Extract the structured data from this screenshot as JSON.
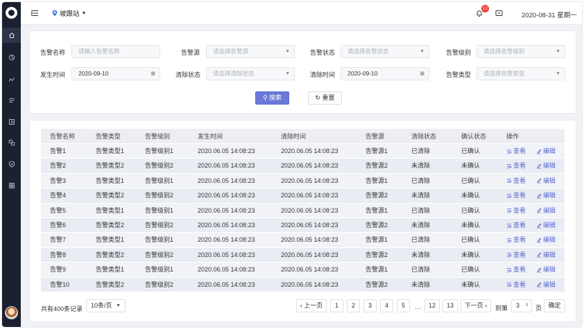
{
  "header": {
    "station": "坡跟站",
    "notification_count": "12",
    "datetime": "2020-08-31 星期一"
  },
  "sidebar": {
    "items": [
      "home-icon",
      "dashboard-icon",
      "trend-icon",
      "list-icon",
      "layout-icon",
      "resource-icon",
      "shield-icon",
      "apps-icon"
    ]
  },
  "filters": {
    "alarm_name": {
      "label": "告警名称",
      "placeholder": "请输入告警名称"
    },
    "alarm_source": {
      "label": "告警源",
      "placeholder": "请选择告警源"
    },
    "alarm_status": {
      "label": "告警状态",
      "placeholder": "请选择告警状态"
    },
    "alarm_level": {
      "label": "告警级别",
      "placeholder": "请选择告警级别"
    },
    "occur_time": {
      "label": "发生时间",
      "value": "2020-09-10"
    },
    "clear_status": {
      "label": "清除状态",
      "placeholder": "请选择清除状态"
    },
    "clear_time": {
      "label": "清除时间",
      "value": "2020-09-10"
    },
    "alarm_type": {
      "label": "告警类型",
      "placeholder": "请选择告警类型"
    },
    "search_label": "搜索",
    "reset_label": "重置"
  },
  "table": {
    "columns": [
      "告警名称",
      "告警类型",
      "告警级别",
      "发生时间",
      "清除时间",
      "告警源",
      "清除状态",
      "确认状态",
      "操作"
    ],
    "view_label": "查看",
    "edit_label": "编辑",
    "rows": [
      {
        "name": "告警1",
        "type": "告警类型1",
        "level": "告警级别1",
        "occur": "2020.06.05  14:08:23",
        "clear": "2020.06.05  14:08:23",
        "source": "告警源1",
        "clear_status": "已清除",
        "confirm_status": "已确认"
      },
      {
        "name": "告警2",
        "type": "告警类型2",
        "level": "告警级别2",
        "occur": "2020.06.05  14:08:23",
        "clear": "2020.06.05  14:08:23",
        "source": "告警源2",
        "clear_status": "未清除",
        "confirm_status": "未确认"
      },
      {
        "name": "告警3",
        "type": "告警类型1",
        "level": "告警级别1",
        "occur": "2020.06.05  14:08:23",
        "clear": "2020.06.05  14:08:23",
        "source": "告警源1",
        "clear_status": "已清除",
        "confirm_status": "已确认"
      },
      {
        "name": "告警4",
        "type": "告警类型2",
        "level": "告警级别2",
        "occur": "2020.06.05  14:08:23",
        "clear": "2020.06.05  14:08:23",
        "source": "告警源2",
        "clear_status": "未清除",
        "confirm_status": "未确认"
      },
      {
        "name": "告警5",
        "type": "告警类型1",
        "level": "告警级别1",
        "occur": "2020.06.05  14:08:23",
        "clear": "2020.06.05  14:08:23",
        "source": "告警源1",
        "clear_status": "已清除",
        "confirm_status": "已确认"
      },
      {
        "name": "告警6",
        "type": "告警类型2",
        "level": "告警级别2",
        "occur": "2020.06.05  14:08:23",
        "clear": "2020.06.05  14:08:23",
        "source": "告警源2",
        "clear_status": "未清除",
        "confirm_status": "未确认"
      },
      {
        "name": "告警7",
        "type": "告警类型1",
        "level": "告警级别1",
        "occur": "2020.06.05  14:08:23",
        "clear": "2020.06.05  14:08:23",
        "source": "告警源1",
        "clear_status": "已清除",
        "confirm_status": "已确认"
      },
      {
        "name": "告警8",
        "type": "告警类型2",
        "level": "告警级别2",
        "occur": "2020.06.05  14:08:23",
        "clear": "2020.06.05  14:08:23",
        "source": "告警源2",
        "clear_status": "未清除",
        "confirm_status": "未确认"
      },
      {
        "name": "告警9",
        "type": "告警类型1",
        "level": "告警级别1",
        "occur": "2020.06.05  14:08:23",
        "clear": "2020.06.05  14:08:23",
        "source": "告警源1",
        "clear_status": "已清除",
        "confirm_status": "已确认"
      },
      {
        "name": "告警10",
        "type": "告警类型2",
        "level": "告警级别2",
        "occur": "2020.06.05  14:08:23",
        "clear": "2020.06.05  14:08:23",
        "source": "告警源2",
        "clear_status": "未清除",
        "confirm_status": "未确认"
      }
    ]
  },
  "pagination": {
    "total": "共有400条记录",
    "page_size": "10条/页",
    "prev": "上一页",
    "next": "下一页",
    "pages": [
      "1",
      "2",
      "3",
      "4",
      "5",
      "…",
      "12",
      "13"
    ],
    "goto_prefix": "到第",
    "goto_value": "3",
    "goto_suffix": "页",
    "confirm": "确定"
  },
  "colors": {
    "primary": "#6a79d8",
    "sidebar": "#1b2131",
    "badge": "#f04134"
  }
}
